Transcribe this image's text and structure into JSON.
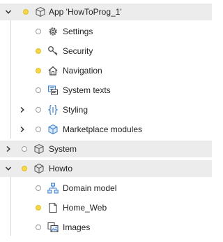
{
  "tree": {
    "app": {
      "label": "App 'HowToProg_1'"
    },
    "settings": {
      "label": "Settings"
    },
    "security": {
      "label": "Security"
    },
    "navigation": {
      "label": "Navigation"
    },
    "system_texts": {
      "label": "System texts"
    },
    "styling": {
      "label": "Styling"
    },
    "marketplace": {
      "label": "Marketplace modules"
    },
    "system": {
      "label": "System"
    },
    "howto": {
      "label": "Howto"
    },
    "domain_model": {
      "label": "Domain model"
    },
    "home_web": {
      "label": "Home_Web"
    },
    "images": {
      "label": "Images"
    }
  },
  "colors": {
    "status_yellow": "#f5d64a",
    "row_highlight": "#ececec",
    "icon_blue": "#3b7fd1"
  }
}
